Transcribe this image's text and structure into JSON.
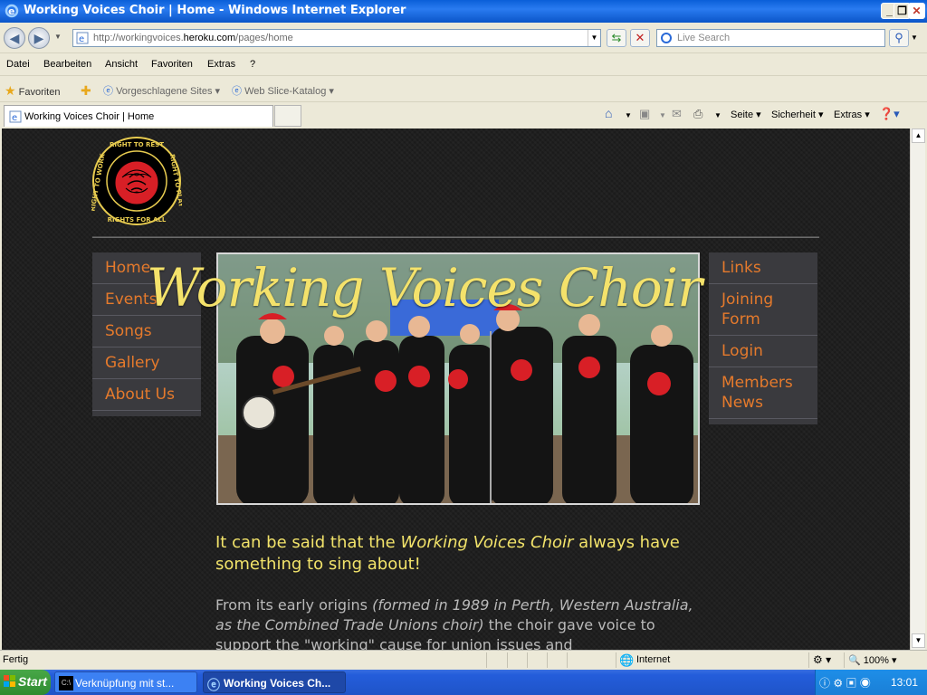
{
  "window": {
    "title": "Working Voices Choir | Home - Windows Internet Explorer",
    "minimize": "_",
    "restore": "❐",
    "close": "✕"
  },
  "address": {
    "url_prefix": "http://workingvoices.",
    "url_domain": "heroku.com",
    "url_suffix": "/pages/home",
    "search_placeholder": "Live Search"
  },
  "menu": [
    "Datei",
    "Bearbeiten",
    "Ansicht",
    "Favoriten",
    "Extras",
    "?"
  ],
  "favorites": {
    "favorites_label": "Favoriten",
    "suggested_sites": "Vorgeschlagene Sites",
    "web_slice": "Web Slice-Katalog"
  },
  "tab": {
    "label": "Working Voices Choir | Home"
  },
  "commands": {
    "page": "Seite",
    "security": "Sicherheit",
    "tools": "Extras"
  },
  "page": {
    "logo_text_top": "RIGHT TO REST",
    "logo_text_left": "RIGHT TO WORK",
    "logo_text_right": "RIGHT TO PLAY",
    "logo_text_bottom": "RIGHTS FOR ALL",
    "site_title": "Working Voices Choir",
    "left_nav": [
      "Home",
      "Events",
      "Songs",
      "Gallery",
      "About Us"
    ],
    "right_nav": [
      "Links",
      "Joining Form",
      "Login",
      "Members News"
    ],
    "intro_part1": "It can be said that the ",
    "intro_italic": "Working Voices Choir",
    "intro_part2": " always have something to sing about!",
    "body_part1": "From its early origins ",
    "body_italic": "(formed in 1989 in Perth, Western Australia, as the Combined Trade Unions choir)",
    "body_part2": " the choir gave voice to support the \"working\" cause for union issues and"
  },
  "status": {
    "text": "Fertig",
    "zone": "Internet",
    "zoom": "100%"
  },
  "taskbar": {
    "start": "Start",
    "task1": "Verknüpfung mit st...",
    "task2": "Working Voices Ch...",
    "clock": "13:01"
  },
  "colors": {
    "nav_link": "#e57a2c",
    "title_yellow": "#f4e26b",
    "page_bg": "#1b1b1b"
  }
}
